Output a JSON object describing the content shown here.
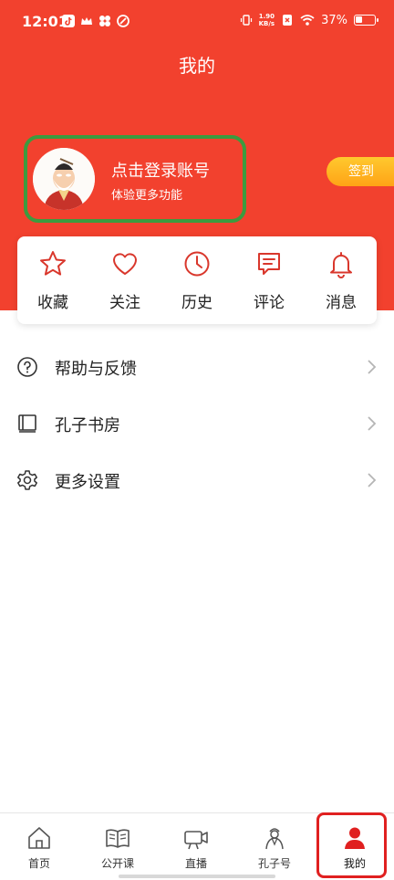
{
  "status_bar": {
    "time": "12:01",
    "net_speed_value": "1.90",
    "net_speed_unit": "KB/s",
    "battery": "37%",
    "battery_level": 0.37
  },
  "header": {
    "title": "我的",
    "background": "#f2412e"
  },
  "profile": {
    "login_title": "点击登录账号",
    "login_subtitle": "体验更多功能",
    "checkin_label": "签到"
  },
  "quick_actions": [
    {
      "label": "收藏",
      "icon": "star-icon"
    },
    {
      "label": "关注",
      "icon": "heart-icon"
    },
    {
      "label": "历史",
      "icon": "clock-icon"
    },
    {
      "label": "评论",
      "icon": "comment-icon"
    },
    {
      "label": "消息",
      "icon": "bell-icon"
    }
  ],
  "menu": [
    {
      "label": "帮助与反馈",
      "icon": "question-icon"
    },
    {
      "label": "孔子书房",
      "icon": "book-icon"
    },
    {
      "label": "更多设置",
      "icon": "gear-icon"
    }
  ],
  "tabbar": [
    {
      "label": "首页",
      "icon": "home-icon"
    },
    {
      "label": "公开课",
      "icon": "open-book-icon"
    },
    {
      "label": "直播",
      "icon": "video-camera-icon"
    },
    {
      "label": "孔子号",
      "icon": "confucius-icon"
    },
    {
      "label": "我的",
      "icon": "person-icon",
      "active": true
    }
  ],
  "colors": {
    "accent": "#e02020",
    "icon_red": "#d9372c",
    "highlight_green": "#3c9b3f",
    "checkin_gold": "#ffb020"
  }
}
